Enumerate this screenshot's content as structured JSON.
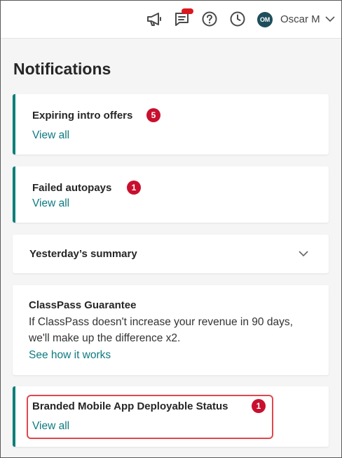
{
  "header": {
    "user_initials": "OM",
    "user_name": "Oscar M",
    "icons": [
      "megaphone-icon",
      "messages-icon",
      "help-icon",
      "clock-icon",
      "chevron-down-icon"
    ]
  },
  "page": {
    "title": "Notifications"
  },
  "cards": {
    "expiring": {
      "title": "Expiring intro offers",
      "badge": "5",
      "link": "View all"
    },
    "failed": {
      "title": "Failed autopays",
      "badge": "1",
      "link": "View all"
    },
    "summary": {
      "title": "Yesterday’s summary"
    },
    "guarantee": {
      "title": "ClassPass Guarantee",
      "line1": "If ClassPass doesn't increase your revenue in 90 days,",
      "line2": "we'll make up the difference x2.",
      "link": "See how it works"
    },
    "branded": {
      "title": "Branded Mobile App Deployable Status",
      "badge": "1",
      "link": "View all"
    }
  },
  "colors": {
    "accent": "#0d7f7a",
    "link": "#0d7a80",
    "badge": "#c8102e",
    "highlight": "#e0474e",
    "avatar": "#1e4e5c"
  }
}
